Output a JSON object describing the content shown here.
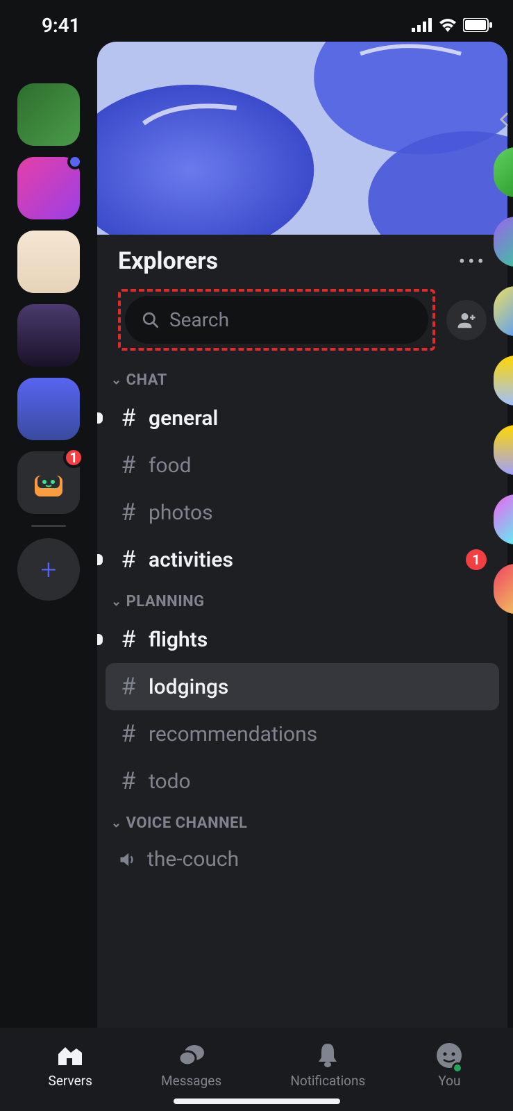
{
  "status": {
    "time": "9:41"
  },
  "server": {
    "name": "Explorers",
    "search_placeholder": "Search"
  },
  "server_rail": {
    "items": [
      {
        "id": "server-1"
      },
      {
        "id": "server-2",
        "notification": true
      },
      {
        "id": "server-3"
      },
      {
        "id": "server-4"
      },
      {
        "id": "server-5"
      },
      {
        "id": "server-6",
        "badge": "1"
      }
    ]
  },
  "categories": [
    {
      "name": "CHAT",
      "channels": [
        {
          "name": "general",
          "unread": true
        },
        {
          "name": "food"
        },
        {
          "name": "photos"
        },
        {
          "name": "activities",
          "unread": true,
          "badge": "1"
        }
      ]
    },
    {
      "name": "PLANNING",
      "channels": [
        {
          "name": "flights",
          "unread": true
        },
        {
          "name": "lodgings",
          "selected": true
        },
        {
          "name": "recommendations"
        },
        {
          "name": "todo"
        }
      ]
    },
    {
      "name": "VOICE CHANNEL",
      "channels": [
        {
          "name": "the-couch",
          "voice": true
        }
      ]
    }
  ],
  "nav": {
    "items": [
      {
        "label": "Servers",
        "active": true
      },
      {
        "label": "Messages"
      },
      {
        "label": "Notifications"
      },
      {
        "label": "You"
      }
    ]
  }
}
